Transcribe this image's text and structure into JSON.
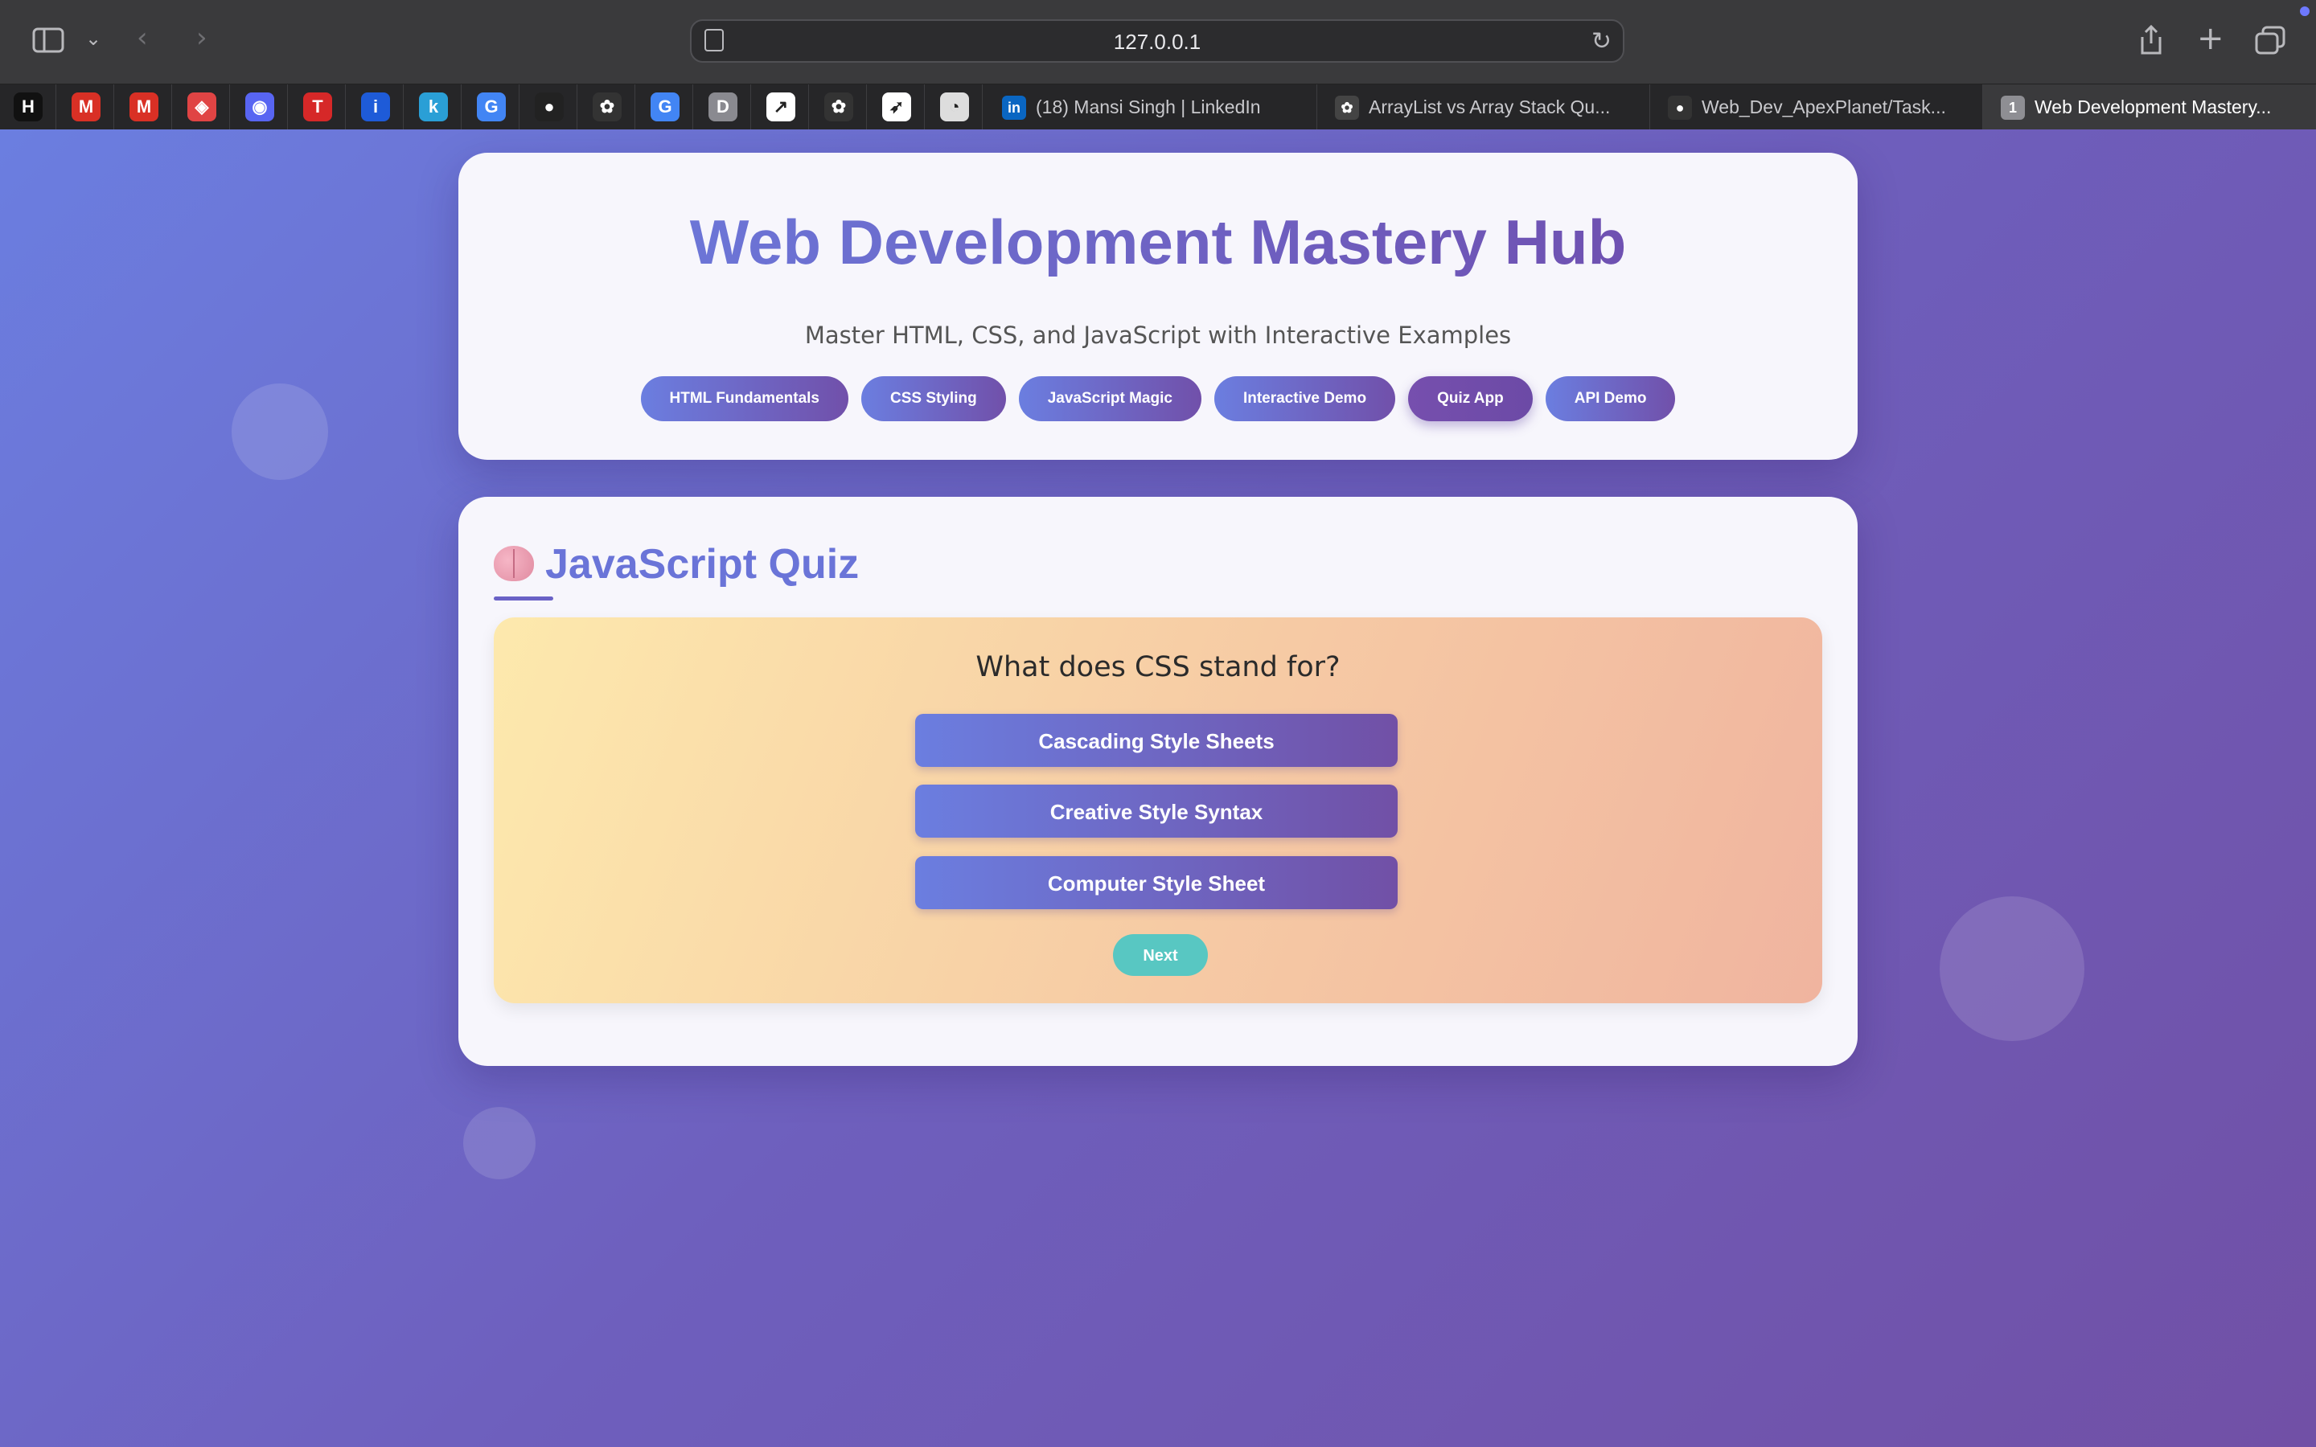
{
  "browser": {
    "url": "127.0.0.1",
    "pinned_tabs": [
      {
        "icon": "nh-icon",
        "glyph": "H",
        "color": "#111111"
      },
      {
        "icon": "gmail-icon",
        "glyph": "M",
        "color": "#d93025"
      },
      {
        "icon": "gmail-icon",
        "glyph": "M",
        "color": "#d93025"
      },
      {
        "icon": "cube-icon",
        "glyph": "◈",
        "color": "#e04444"
      },
      {
        "icon": "discord-icon",
        "glyph": "◉",
        "color": "#5865f2"
      },
      {
        "icon": "tuf-icon",
        "glyph": "T",
        "color": "#d62828"
      },
      {
        "icon": "bars-icon",
        "glyph": "i",
        "color": "#1e5bd8"
      },
      {
        "icon": "k-icon",
        "glyph": "k",
        "color": "#2a9fd6"
      },
      {
        "icon": "google-icon",
        "glyph": "G",
        "color": "#4285f4"
      },
      {
        "icon": "github-icon",
        "glyph": "●",
        "color": "#222222"
      },
      {
        "icon": "openai-icon",
        "glyph": "✿",
        "color": "#333333"
      },
      {
        "icon": "google-icon",
        "glyph": "G",
        "color": "#4285f4"
      },
      {
        "icon": "d-icon",
        "glyph": "D",
        "color": "#8a8a90"
      },
      {
        "icon": "chart-icon",
        "glyph": "↗",
        "color": "#ffffff"
      },
      {
        "icon": "openai-icon",
        "glyph": "✿",
        "color": "#333333"
      },
      {
        "icon": "rocket-icon",
        "glyph": "➶",
        "color": "#ffffff"
      },
      {
        "icon": "clock-icon",
        "glyph": "◔",
        "color": "#dddddd"
      }
    ],
    "tabs": [
      {
        "label": "(18) Mansi Singh | LinkedIn",
        "icon": "linkedin-icon",
        "glyph": "in",
        "color": "#0a66c2"
      },
      {
        "label": "ArrayList vs Array Stack Qu...",
        "icon": "openai-icon",
        "glyph": "✿",
        "color": "#444444"
      },
      {
        "label": "Web_Dev_ApexPlanet/Task...",
        "icon": "github-icon",
        "glyph": "●",
        "color": "#333333"
      },
      {
        "label": "Web Development Mastery...",
        "icon": "tab-number-icon",
        "glyph": "1",
        "color": "#8e8e93"
      }
    ]
  },
  "header": {
    "title": "Web Development Mastery Hub",
    "subtitle": "Master HTML, CSS, and JavaScript with Interactive Examples",
    "nav": [
      "HTML Fundamentals",
      "CSS Styling",
      "JavaScript Magic",
      "Interactive Demo",
      "Quiz App",
      "API Demo"
    ],
    "active_nav": "Quiz App"
  },
  "quiz": {
    "heading": "JavaScript Quiz",
    "question": "What does CSS stand for?",
    "options": [
      "Cascading Style Sheets",
      "Creative Style Syntax",
      "Computer Style Sheet"
    ],
    "next_label": "Next"
  },
  "colors": {
    "accent": "#6b7ee0",
    "accent_dark": "#7150a6",
    "next_button": "#58c7c2"
  }
}
